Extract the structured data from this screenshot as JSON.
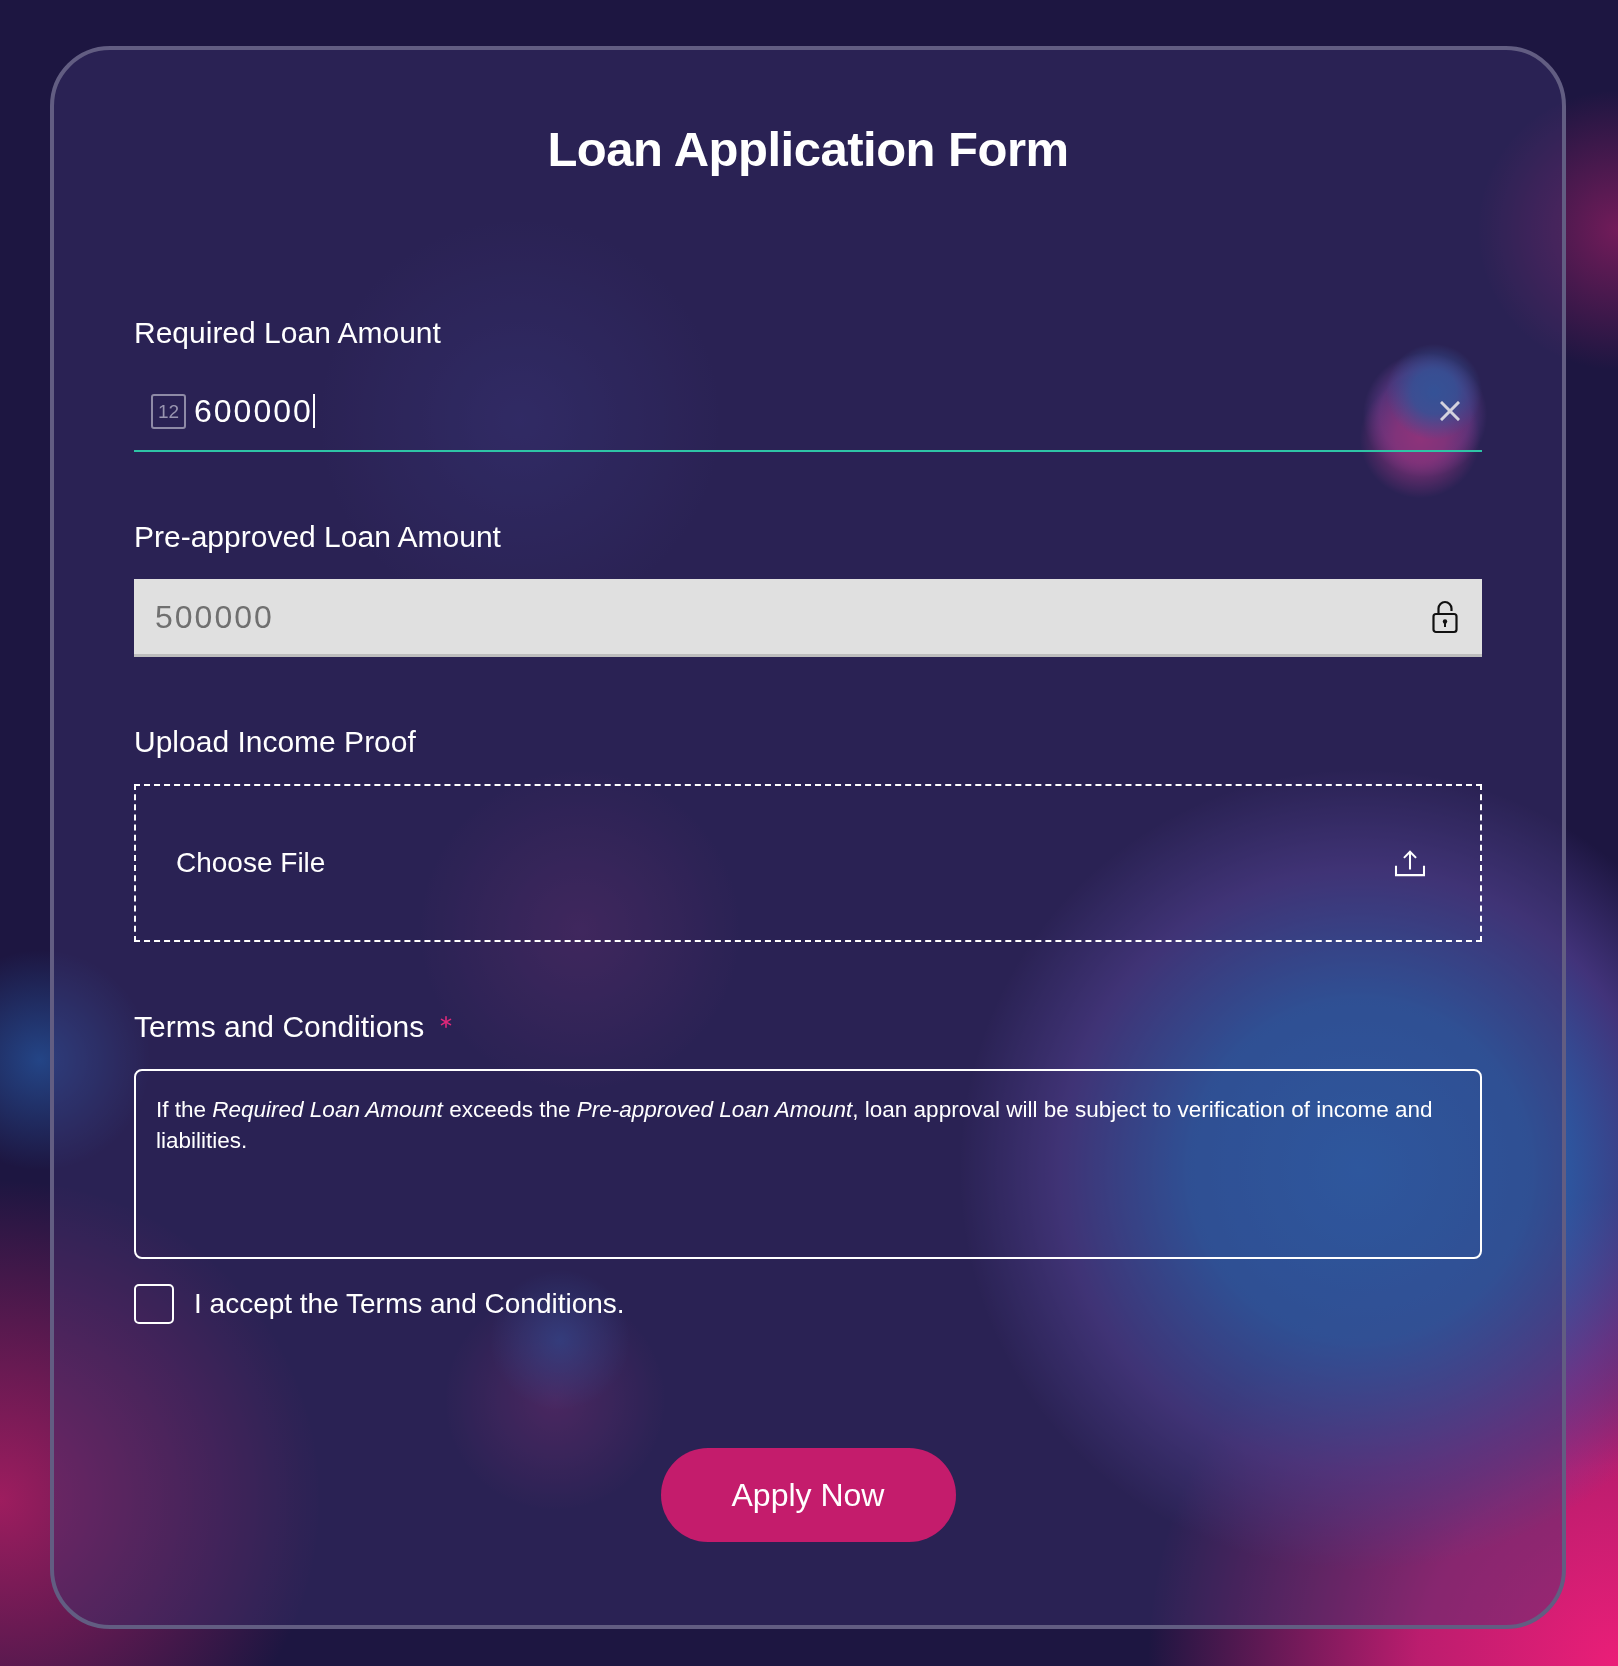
{
  "title": "Loan Application Form",
  "fields": [
    {
      "kind": "number",
      "label": "Required Loan Amount",
      "badge": "12",
      "value": "600000",
      "focused": true,
      "required": false
    },
    {
      "kind": "locked",
      "label": "Pre-approved Loan Amount",
      "value": "500000",
      "required": false
    },
    {
      "kind": "file",
      "label": "Upload Income Proof",
      "button": "Choose File",
      "required": false
    },
    {
      "kind": "terms",
      "label": "Terms and Conditions",
      "required": true,
      "text": "If the *Required Loan Amount* exceeds the *Pre-approved Loan Amount*, loan approval will be subject to verification of income and liabilities."
    }
  ],
  "agreement": {
    "label": "I accept the Terms and Conditions.",
    "checked": false
  },
  "submit_button": {
    "label": "Apply Now"
  }
}
